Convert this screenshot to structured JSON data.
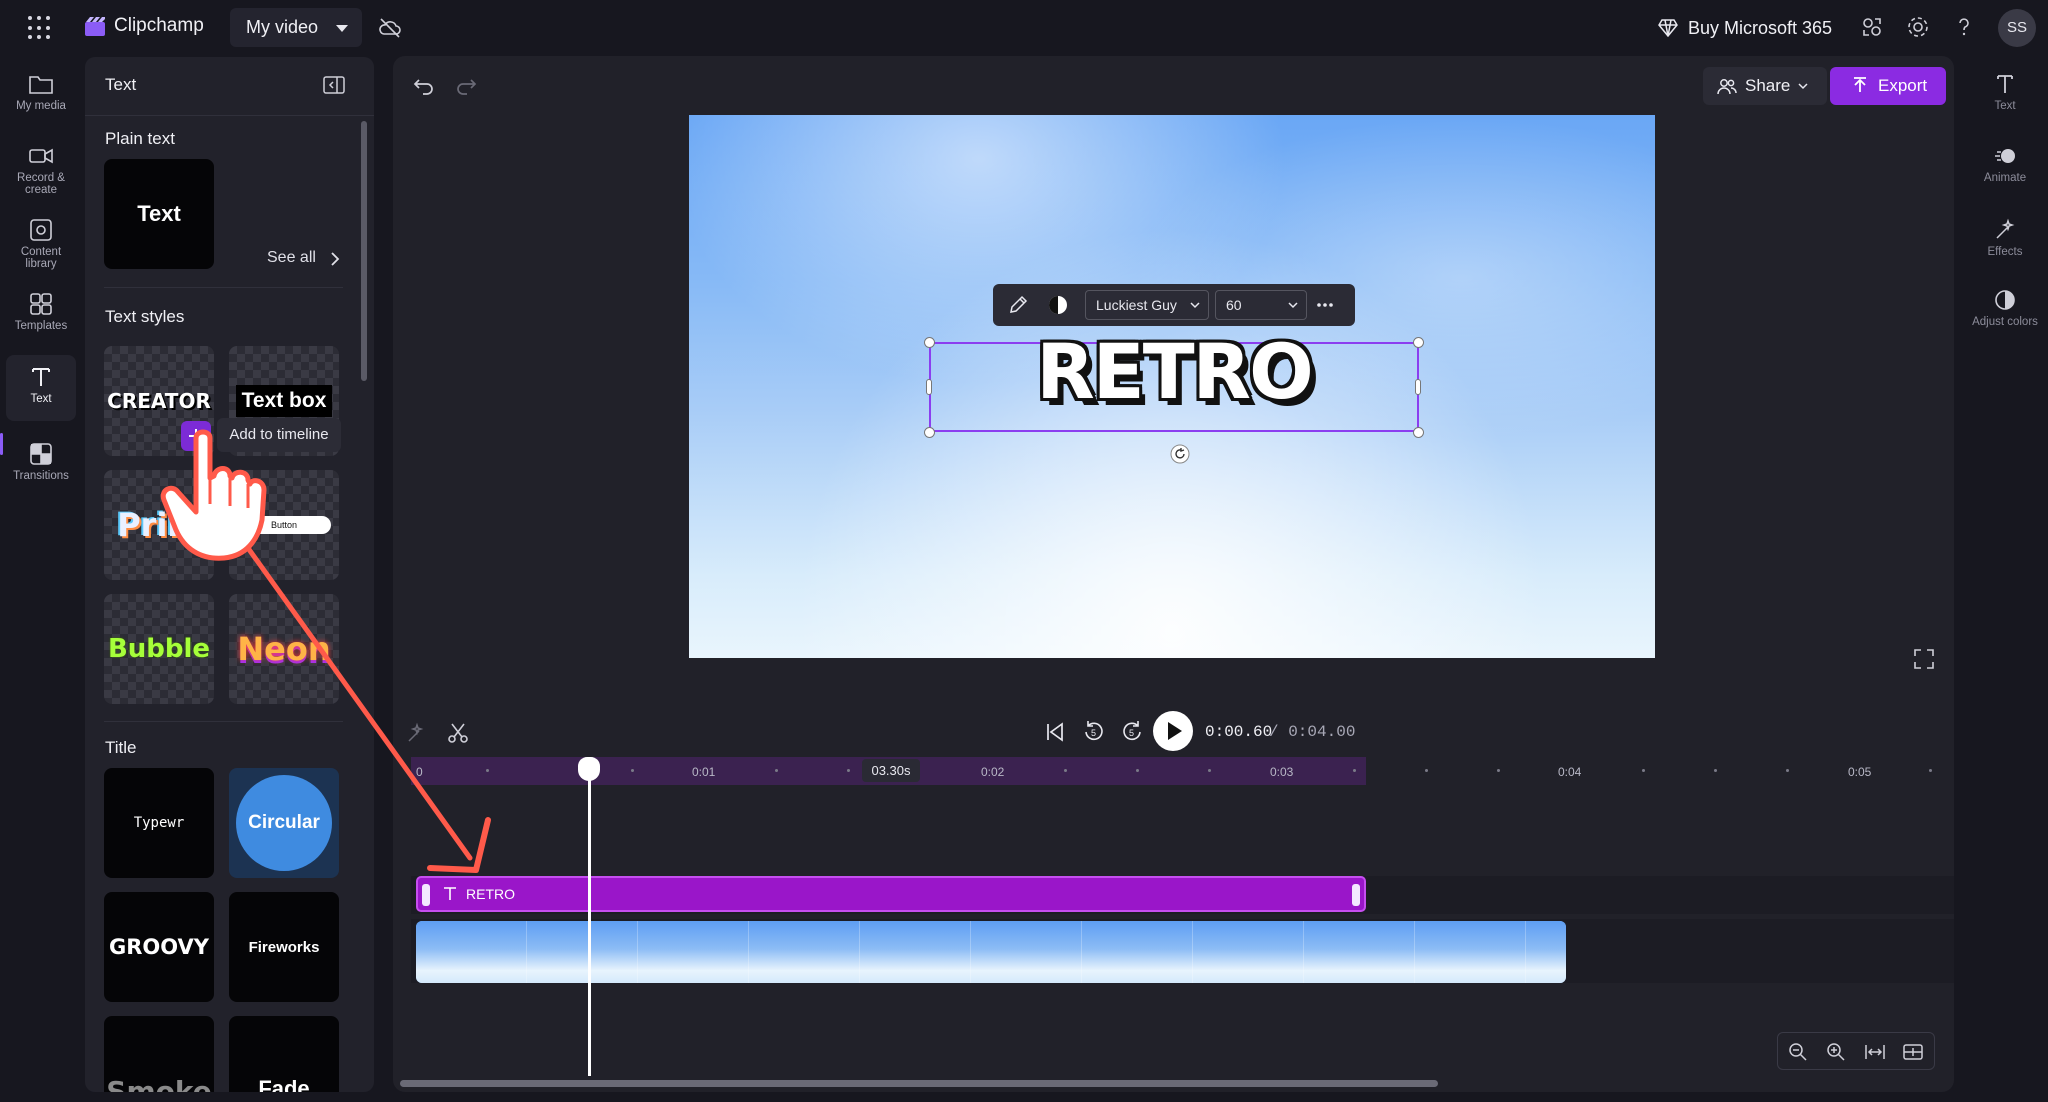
{
  "app": {
    "name": "Clipchamp",
    "project": "My video"
  },
  "topbar": {
    "buy": "Buy Microsoft 365",
    "avatar": "SS"
  },
  "leftnav": [
    {
      "label": "My media"
    },
    {
      "label": "Record & create"
    },
    {
      "label": "Content library"
    },
    {
      "label": "Templates"
    },
    {
      "label": "Text"
    },
    {
      "label": "Transitions"
    }
  ],
  "panel": {
    "title": "Text",
    "plain_text": {
      "heading": "Plain text",
      "tile": "Text"
    },
    "styles": {
      "heading": "Text styles",
      "see_all": "See all"
    },
    "tooltip": "Add to timeline",
    "style_tiles": [
      "CREATOR",
      "Text box",
      "Prim",
      "Button",
      "Bubble",
      "Neon"
    ],
    "title_section": {
      "heading": "Title"
    },
    "title_tiles": [
      "Typewr",
      "Circular",
      "GROOVY",
      "Fireworks",
      "Smoke",
      "Fade"
    ]
  },
  "editor": {
    "share": "Share",
    "export": "Export",
    "canvas_text": "RETRO",
    "font": "Luckiest Guy",
    "font_size": "60"
  },
  "transport": {
    "current": "0:00.60",
    "total": "/ 0:04.00",
    "skip": "5"
  },
  "timeline": {
    "ticks": [
      "0",
      "0:01",
      "0:02",
      "0:03",
      "0:04",
      "0:05"
    ],
    "marker": "03.30s",
    "text_clip": "RETRO"
  },
  "rightnav": [
    {
      "label": "Text"
    },
    {
      "label": "Animate"
    },
    {
      "label": "Effects"
    },
    {
      "label": "Adjust colors"
    }
  ],
  "colors": {
    "accent": "#8b2be2",
    "text_clip": "#9a16c9",
    "background": "#17171f"
  }
}
